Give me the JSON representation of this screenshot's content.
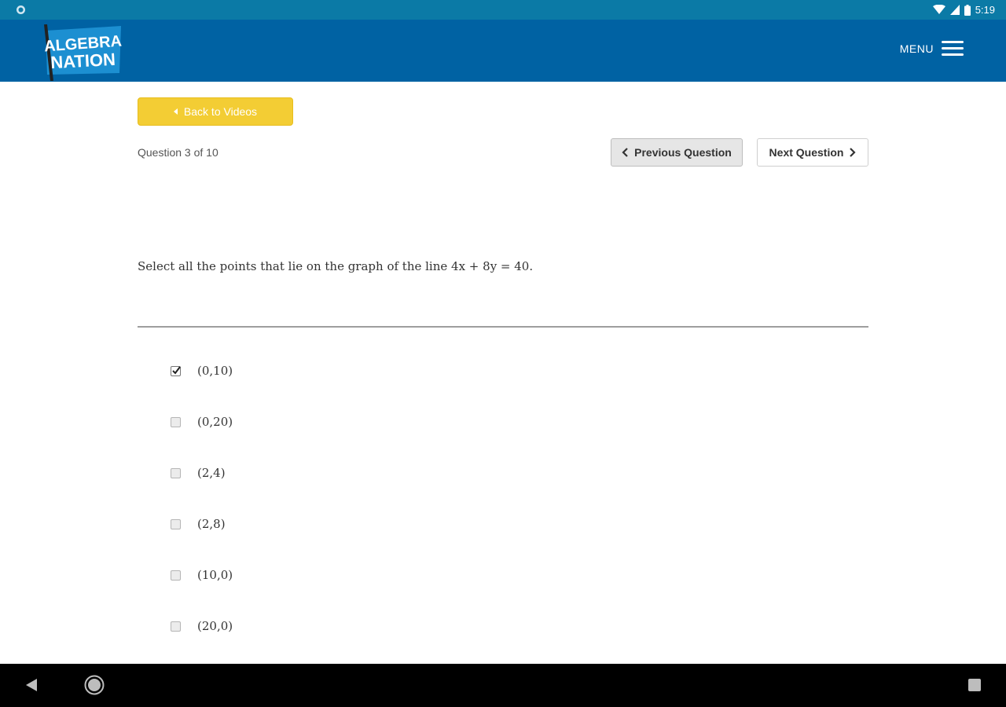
{
  "status_bar": {
    "time": "5:19",
    "icons": [
      "app-notification-icon",
      "wifi-icon",
      "signal-icon",
      "battery-icon"
    ]
  },
  "header": {
    "logo_line1": "ALGEBRA",
    "logo_line2": "NATION",
    "menu_label": "MENU",
    "colors": {
      "status_bar": "#0b7aa6",
      "app_bar": "#0062a3"
    }
  },
  "toolbar": {
    "back_label": "Back to Videos",
    "back_color": "#f3cd34",
    "question_count": "Question 3 of 10",
    "prev_label": "Previous Question",
    "next_label": "Next Question"
  },
  "question": {
    "text": "Select all the points that lie on the graph of the line 4x + 8y = 40."
  },
  "options": [
    {
      "label": "(0,10)",
      "checked": true
    },
    {
      "label": "(0,20)",
      "checked": false
    },
    {
      "label": "(2,4)",
      "checked": false
    },
    {
      "label": "(2,8)",
      "checked": false
    },
    {
      "label": "(10,0)",
      "checked": false
    },
    {
      "label": "(20,0)",
      "checked": false
    }
  ],
  "system_nav": {
    "icons": [
      "back-icon",
      "home-icon",
      "recents-icon"
    ]
  }
}
